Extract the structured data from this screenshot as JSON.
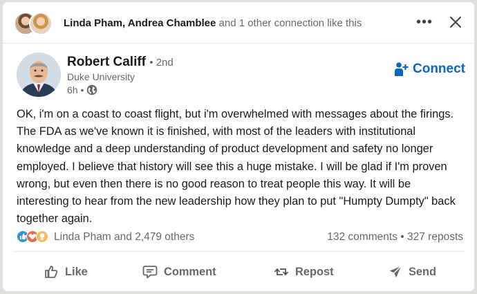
{
  "social_context": {
    "name1": "Linda Pham",
    "name2": "Andrea Chamblee",
    "suffix": "and 1 other connection like this",
    "more_label": "•••"
  },
  "author": {
    "name": "Robert Califf",
    "degree": "• 2nd",
    "headline": "Duke University",
    "time": "6h •",
    "visibility_icon": "globe-icon"
  },
  "connect_label": "Connect",
  "post": {
    "text": "OK, i'm on a coast to coast flight, but i'm overwhelmed with messages about the firings. The FDA as we've known it is finished, with most of the leaders with institutional knowledge and a deep understanding of product development and safety no longer employed. I believe that history will see this a huge mistake. I will be glad if I'm proven wrong, but even then there is no good reason to treat people this way. It will be interesting to hear from the new leadership how they plan to put \"Humpty Dumpty\" back together again."
  },
  "counts": {
    "reactions_text": "Linda Pham and 2,479 others",
    "comments": "132 comments",
    "separator": "•",
    "reposts": "327 reposts",
    "reaction_icons": [
      "like-icon",
      "love-icon",
      "insightful-icon"
    ]
  },
  "actions": {
    "like": "Like",
    "comment": "Comment",
    "repost": "Repost",
    "send": "Send"
  },
  "colors": {
    "accent": "#0a66c2",
    "background": "#dfdfdc",
    "card": "#ffffff"
  }
}
